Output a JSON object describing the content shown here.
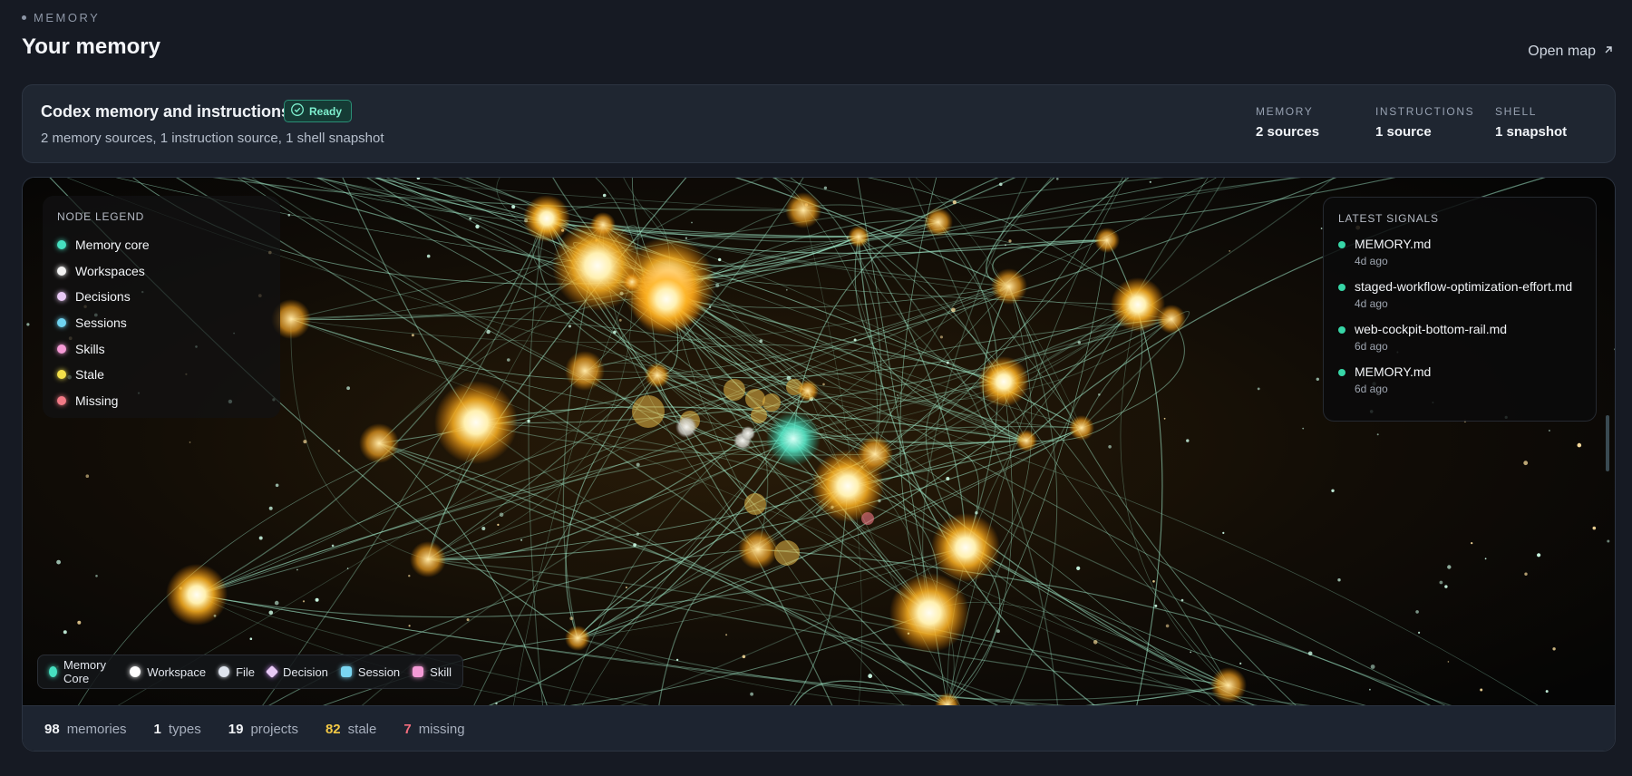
{
  "header": {
    "eyebrow": "MEMORY",
    "title": "Your memory",
    "open_map_label": "Open map"
  },
  "summary": {
    "title": "Codex memory and instructions",
    "status_badge": "Ready",
    "subtitle": "2 memory sources, 1 instruction source, 1 shell snapshot",
    "stats": [
      {
        "label": "MEMORY",
        "value": "2 sources"
      },
      {
        "label": "INSTRUCTIONS",
        "value": "1 source"
      },
      {
        "label": "SHELL",
        "value": "1 snapshot"
      }
    ]
  },
  "node_legend": {
    "title": "NODE LEGEND",
    "items": [
      {
        "label": "Memory core",
        "color": "#46e0c0"
      },
      {
        "label": "Workspaces",
        "color": "#f2f2f2"
      },
      {
        "label": "Decisions",
        "color": "#e8c9f5"
      },
      {
        "label": "Sessions",
        "color": "#6fd3f0"
      },
      {
        "label": "Skills",
        "color": "#f59ad6"
      },
      {
        "label": "Stale",
        "color": "#f3e04a"
      },
      {
        "label": "Missing",
        "color": "#f27a86"
      }
    ]
  },
  "latest_signals": {
    "title": "LATEST SIGNALS",
    "items": [
      {
        "name": "MEMORY.md",
        "ago": "4d ago"
      },
      {
        "name": "staged-workflow-optimization-effort.md",
        "ago": "4d ago"
      },
      {
        "name": "web-cockpit-bottom-rail.md",
        "ago": "6d ago"
      },
      {
        "name": "MEMORY.md",
        "ago": "6d ago"
      }
    ]
  },
  "type_legend": [
    {
      "label": "Memory Core",
      "shape": "circle",
      "color": "#46e0c0"
    },
    {
      "label": "Workspace",
      "shape": "circle",
      "color": "#ffffff"
    },
    {
      "label": "File",
      "shape": "circle",
      "color": "#dfe4ee"
    },
    {
      "label": "Decision",
      "shape": "diamond",
      "color": "#e8c9f5"
    },
    {
      "label": "Session",
      "shape": "square",
      "color": "#7ad6f2"
    },
    {
      "label": "Skill",
      "shape": "square",
      "color": "#f59ad6"
    }
  ],
  "footer_stats": [
    {
      "value": "98",
      "label": "memories",
      "tone": "normal"
    },
    {
      "value": "1",
      "label": "types",
      "tone": "normal"
    },
    {
      "value": "19",
      "label": "projects",
      "tone": "normal"
    },
    {
      "value": "82",
      "label": "stale",
      "tone": "warn"
    },
    {
      "value": "7",
      "label": "missing",
      "tone": "err"
    }
  ],
  "colors": {
    "accent": "#46e0c0",
    "edge": "#9fe8c8",
    "node_glow": "#ffb020",
    "stale": "#f3c845",
    "missing": "#f26d7d"
  }
}
